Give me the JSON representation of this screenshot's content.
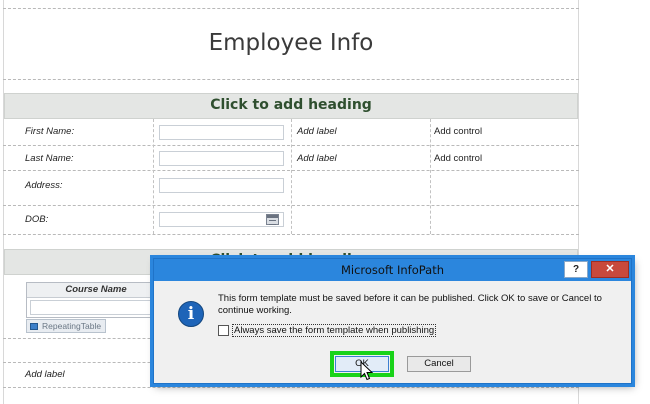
{
  "form": {
    "title": "Employee Info",
    "heading": "Click to add heading",
    "heading2": "Click to add heading",
    "rows": [
      {
        "label": "First Name:",
        "add_label": "Add label",
        "add_control": "Add control"
      },
      {
        "label": "Last Name:",
        "add_label": "Add label",
        "add_control": "Add control"
      },
      {
        "label": "Address:"
      },
      {
        "label": "DOB:"
      }
    ],
    "repeating_table": {
      "column": "Course Name",
      "tag": "RepeatingTable"
    },
    "bottom_label": "Add label"
  },
  "dialog": {
    "title": "Microsoft InfoPath",
    "help_label": "?",
    "close_label": "✕",
    "icon": "info-icon",
    "message": "This form template must be saved before it can be published. Click OK to save or Cancel to continue working.",
    "checkbox_label": "Always save the form template when publishing",
    "checkbox_checked": false,
    "ok_label": "OK",
    "cancel_label": "Cancel",
    "highlight_color": "#19d319"
  }
}
